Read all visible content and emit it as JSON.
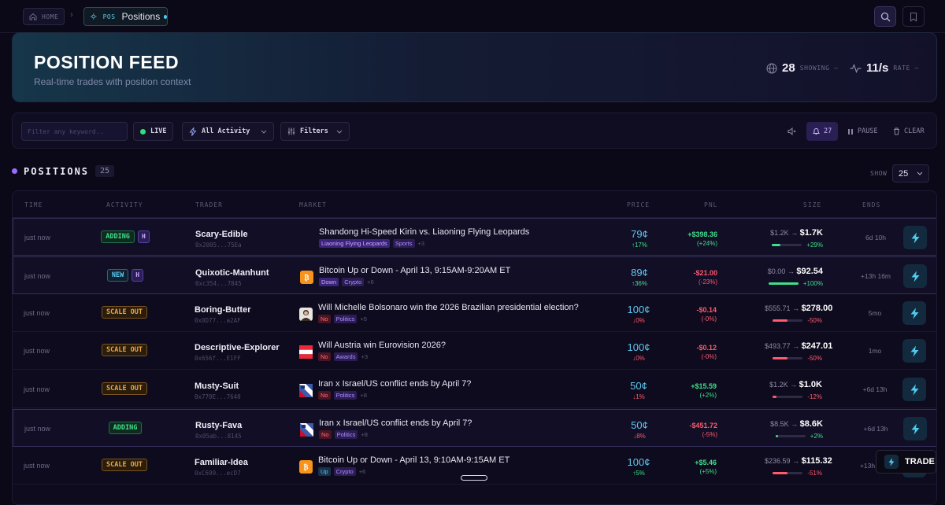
{
  "nav": {
    "home_label": "HOME",
    "pos_tag": "POS",
    "pos_label": "Positions"
  },
  "hero": {
    "title": "POSITION FEED",
    "subtitle": "Real-time trades with position context",
    "showing_value": "28",
    "showing_label": "SHOWING –",
    "rate_value": "11/s",
    "rate_label": "RATE –"
  },
  "toolbar": {
    "filter_placeholder": "Filter any keyword..",
    "live_label": "LIVE",
    "activity_label": "All Activity",
    "filters_label": "Filters",
    "notif_count": "27",
    "pause_label": "PAUSE",
    "clear_label": "CLEAR"
  },
  "section": {
    "title": "POSITIONS",
    "count": "25",
    "show_label": "SHOW",
    "show_value": "25"
  },
  "columns": [
    "TIME",
    "ACTIVITY",
    "TRADER",
    "MARKET",
    "PRICE",
    "PNL",
    "SIZE",
    "ENDS"
  ],
  "rows": [
    {
      "time": "just now",
      "activity": "ADDING",
      "activity_type": "adding",
      "h": "H",
      "trader": "Scary-Edible",
      "address": "0x2005...75Ea",
      "market": "Shandong Hi-Speed Kirin vs. Liaoning Flying Leopards",
      "icon": "none",
      "tags": [
        {
          "text": "Liaoning Flying Leopards",
          "style": "purple"
        },
        {
          "text": "Sports",
          "style": "cat"
        }
      ],
      "more": "+3",
      "price": "79¢",
      "price_change": "↑17%",
      "price_dir": "up",
      "pnl": "+$398.36",
      "pnl_pct": "(+24%)",
      "pnl_dir": "up",
      "size_from": "$1.2K",
      "size_to": "$1.7K",
      "size_pct": "+29%",
      "size_dir": "up",
      "size_fill": 0.29,
      "ends": "6d 10h",
      "highlight": true
    },
    {
      "time": "just now",
      "activity": "NEW",
      "activity_type": "new",
      "h": "H",
      "trader": "Quixotic-Manhunt",
      "address": "0xc354...7845",
      "market": "Bitcoin Up or Down - April 13, 9:15AM-9:20AM ET",
      "icon": "bitcoin",
      "tags": [
        {
          "text": "Down",
          "style": "purple"
        },
        {
          "text": "Crypto",
          "style": "cat"
        }
      ],
      "more": "+6",
      "price": "89¢",
      "price_change": "↑36%",
      "price_dir": "up",
      "pnl": "-$21.00",
      "pnl_pct": "(-23%)",
      "pnl_dir": "down",
      "size_from": "$0.00",
      "size_to": "$92.54",
      "size_pct": "+100%",
      "size_dir": "up",
      "size_fill": 1.0,
      "ends": "+13h 16m",
      "highlight": true
    },
    {
      "time": "just now",
      "activity": "SCALE OUT",
      "activity_type": "scale",
      "h": "",
      "trader": "Boring-Butter",
      "address": "0x0D77...a2AF",
      "market": "Will Michelle Bolsonaro win the 2026 Brazilian presidential election?",
      "icon": "portrait",
      "tags": [
        {
          "text": "No",
          "style": "red"
        },
        {
          "text": "Politics",
          "style": "cat"
        }
      ],
      "more": "+5",
      "price": "100¢",
      "price_change": "↓0%",
      "price_dir": "down",
      "pnl": "-$0.14",
      "pnl_pct": "(-0%)",
      "pnl_dir": "down",
      "size_from": "$555.71",
      "size_to": "$278.00",
      "size_pct": "-50%",
      "size_dir": "down",
      "size_fill": 0.5,
      "ends": "5mo",
      "highlight": false
    },
    {
      "time": "just now",
      "activity": "SCALE OUT",
      "activity_type": "scale",
      "h": "",
      "trader": "Descriptive-Explorer",
      "address": "0x656f...E1FF",
      "market": "Will Austria win Eurovision 2026?",
      "icon": "austria",
      "tags": [
        {
          "text": "No",
          "style": "red"
        },
        {
          "text": "Awards",
          "style": "cat"
        }
      ],
      "more": "+3",
      "price": "100¢",
      "price_change": "↓0%",
      "price_dir": "down",
      "pnl": "-$0.12",
      "pnl_pct": "(-0%)",
      "pnl_dir": "down",
      "size_from": "$493.77",
      "size_to": "$247.01",
      "size_pct": "-50%",
      "size_dir": "down",
      "size_fill": 0.5,
      "ends": "1mo",
      "highlight": false
    },
    {
      "time": "just now",
      "activity": "SCALE OUT",
      "activity_type": "scale",
      "h": "",
      "trader": "Musty-Suit",
      "address": "0x770E...7640",
      "market": "Iran x Israel/US conflict ends by April 7?",
      "icon": "flags",
      "tags": [
        {
          "text": "No",
          "style": "red"
        },
        {
          "text": "Politics",
          "style": "cat"
        }
      ],
      "more": "+8",
      "price": "50¢",
      "price_change": "↓1%",
      "price_dir": "down",
      "pnl": "+$15.59",
      "pnl_pct": "(+2%)",
      "pnl_dir": "up",
      "size_from": "$1.2K",
      "size_to": "$1.0K",
      "size_pct": "-12%",
      "size_dir": "down",
      "size_fill": 0.12,
      "ends": "+6d 13h",
      "highlight": false
    },
    {
      "time": "just now",
      "activity": "ADDING",
      "activity_type": "adding",
      "h": "",
      "trader": "Rusty-Fava",
      "address": "0x05ab...8145",
      "market": "Iran x Israel/US conflict ends by April 7?",
      "icon": "flags",
      "tags": [
        {
          "text": "No",
          "style": "red"
        },
        {
          "text": "Politics",
          "style": "cat"
        }
      ],
      "more": "+8",
      "price": "50¢",
      "price_change": "↓8%",
      "price_dir": "down",
      "pnl": "-$451.72",
      "pnl_pct": "(-5%)",
      "pnl_dir": "down",
      "size_from": "$8.5K",
      "size_to": "$8.6K",
      "size_pct": "+2%",
      "size_dir": "up",
      "size_fill": 0.02,
      "ends": "+6d 13h",
      "highlight": true
    },
    {
      "time": "just now",
      "activity": "SCALE OUT",
      "activity_type": "scale",
      "h": "",
      "trader": "Familiar-Idea",
      "address": "0xC699...ecD7",
      "market": "Bitcoin Up or Down - April 13, 9:10AM-9:15AM ET",
      "icon": "bitcoin",
      "tags": [
        {
          "text": "Up",
          "style": "blue"
        },
        {
          "text": "Crypto",
          "style": "cat"
        }
      ],
      "more": "+6",
      "price": "100¢",
      "price_change": "↑5%",
      "price_dir": "up",
      "pnl": "+$5.46",
      "pnl_pct": "(+5%)",
      "pnl_dir": "up",
      "size_from": "$236.59",
      "size_to": "$115.32",
      "size_pct": "-51%",
      "size_dir": "down",
      "size_fill": 0.51,
      "ends": "+13h 16m",
      "highlight": false
    }
  ],
  "float": {
    "trade_label": "TRADE"
  },
  "colors": {
    "accent": "#9b6cff",
    "cyan": "#5ec8f0",
    "green": "#3fe08a",
    "red": "#ff5a6e",
    "orange": "#f0a540"
  }
}
